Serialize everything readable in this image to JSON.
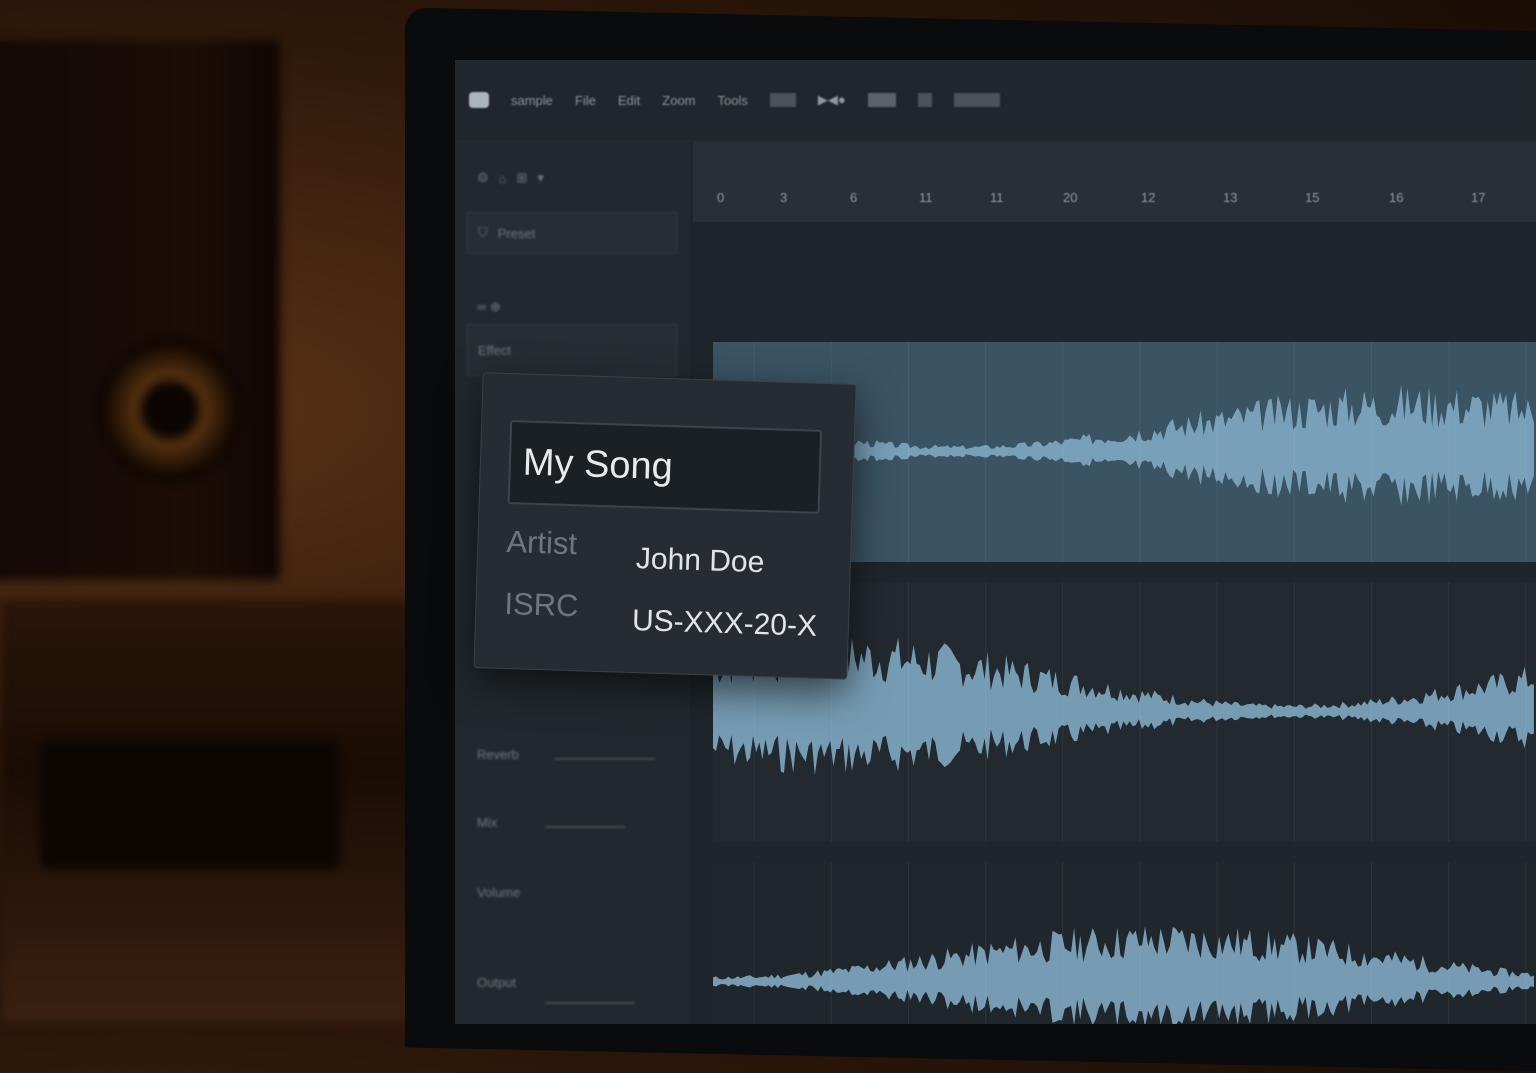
{
  "toolbar": {
    "menu": [
      "sample",
      "File",
      "Edit",
      "Zoom",
      "Tools"
    ],
    "icons": [
      "app-logo-icon",
      "transport-icon"
    ]
  },
  "sidebar": {
    "items": [
      "Preset",
      "Effect",
      "Reverb",
      "Mix",
      "Volume",
      "Output"
    ]
  },
  "ruler": {
    "ticks": [
      "0",
      "3",
      "6",
      "11",
      "11",
      "20",
      "12",
      "13",
      "15",
      "16",
      "17"
    ]
  },
  "metadata": {
    "title": "My Song",
    "artist_label": "Artist",
    "artist_value": "John Doe",
    "isrc_label": "ISRC",
    "isrc_value": "US-XXX-20-X"
  },
  "colors": {
    "waveform": "#7fa9c2",
    "selected_track": "#3a5464"
  }
}
